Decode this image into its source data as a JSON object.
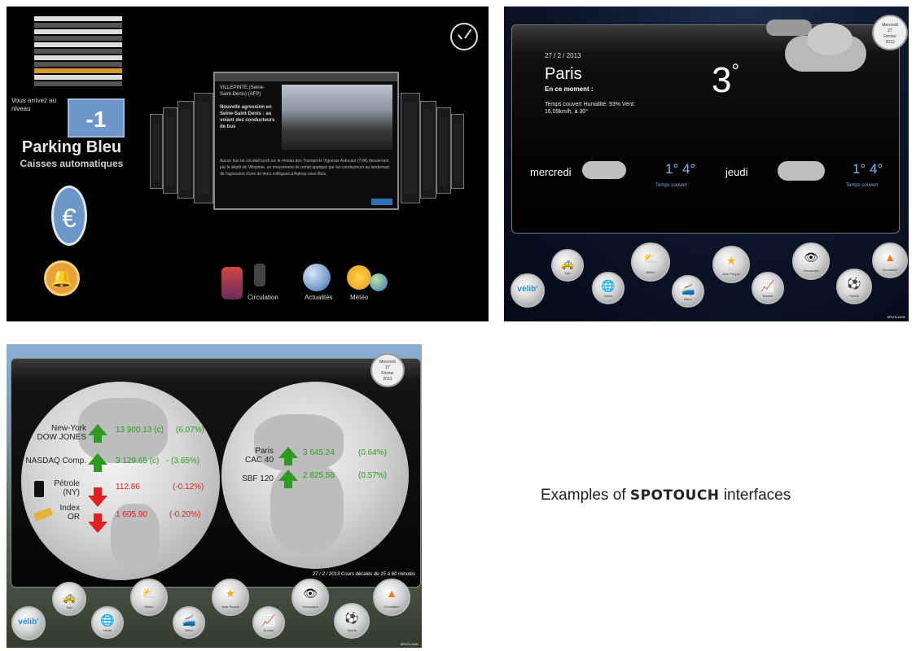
{
  "panel1": {
    "level_message": "Vous arrivez au niveau",
    "level_number": "-1",
    "parking_name": "Parking Bleu",
    "parking_subtitle": "Caisses automatiques",
    "euro_symbol": "€",
    "bell_symbol": "🔔",
    "news_title": "VILLEPINTE (Seine-Saint-Denis) (AFP)",
    "news_subtitle": "Nouvelle agression en Seine-Saint-Denis : au volant des conducteurs de bus",
    "news_body": "Aucun bus ne circulait lundi sur le réseau des Transports Vigneras Autocars (TVA) desservant par le dépôt de Villepinte, un mouvement de retrait appliqué par les conducteurs au lendemain de l'agression d'une de leurs collègues à Aulnay-sous-Bois.",
    "dock_labels": [
      "Circulation",
      "Actualités",
      "Météo"
    ]
  },
  "panel2": {
    "date": "27 / 2 / 2013",
    "city": "Paris",
    "now_label": "En ce moment :",
    "current_desc": "Temps couvert Humidité: 93% Vent: 16.09km/h, à 30°",
    "current_temp": "3",
    "degree": "°",
    "forecast": [
      {
        "day": "mercredi",
        "range": "1° 4°",
        "condition": "Temps couvert"
      },
      {
        "day": "jeudi",
        "range": "1° 4°",
        "condition": "Temps couvert"
      }
    ],
    "calendar": {
      "weekday": "Mercredi",
      "day": "27",
      "month": "Février",
      "year": "2013"
    },
    "dock": [
      {
        "label": "",
        "icon": "velib-logo-icon"
      },
      {
        "label": "Taxi",
        "icon": "taxi-icon"
      },
      {
        "label": "News",
        "icon": "globe-icon"
      },
      {
        "label": "Météo",
        "icon": "weather-icon"
      },
      {
        "label": "Métro",
        "icon": "metro-icon"
      },
      {
        "label": "Actu People",
        "icon": "star-icon"
      },
      {
        "label": "Bourse",
        "icon": "chart-icon"
      },
      {
        "label": "Horoscope",
        "icon": "eye-icon"
      },
      {
        "label": "Sports",
        "icon": "soccer-ball-icon"
      },
      {
        "label": "Circulation",
        "icon": "traffic-cone-icon"
      }
    ],
    "brand": "SPOTLOOK"
  },
  "panel3": {
    "left_rows": [
      {
        "name": "New-York",
        "name2": "DOW JONES",
        "value": "13 900.13 (c)",
        "change": "(6.07%)",
        "dir": "up"
      },
      {
        "name": "NASDAQ Comp.",
        "name2": "",
        "value": "3 129.65 (c)",
        "change": "- (3.65%)",
        "dir": "up"
      },
      {
        "name": "Pétrole",
        "name2": "(NY)",
        "value": "112.86",
        "change": "(-0.12%)",
        "dir": "down"
      },
      {
        "name": "Index",
        "name2": "OR",
        "value": "1 605.90",
        "change": "(-0.20%)",
        "dir": "down"
      }
    ],
    "right_rows": [
      {
        "name": "Paris",
        "name2": "CAC 40",
        "value": "3 645.24",
        "change": "(0.64%)",
        "dir": "up"
      },
      {
        "name": "SBF 120",
        "name2": "",
        "value": "2 825.58",
        "change": "(0.57%)",
        "dir": "up"
      }
    ],
    "footer": "27 / 2 / 2013  Cours décalés de 15 à 60 minutes",
    "calendar": {
      "weekday": "Mercredi",
      "day": "27",
      "month": "Février",
      "year": "2013"
    },
    "dock": [
      {
        "label": "",
        "icon": "velib-logo-icon"
      },
      {
        "label": "Taxi",
        "icon": "taxi-icon"
      },
      {
        "label": "News",
        "icon": "globe-icon"
      },
      {
        "label": "Météo",
        "icon": "weather-icon"
      },
      {
        "label": "Métro",
        "icon": "metro-icon"
      },
      {
        "label": "Actu People",
        "icon": "star-icon"
      },
      {
        "label": "Bourse",
        "icon": "chart-icon"
      },
      {
        "label": "Horoscope",
        "icon": "eye-icon"
      },
      {
        "label": "Sports",
        "icon": "soccer-ball-icon"
      },
      {
        "label": "Circulation",
        "icon": "traffic-cone-icon"
      }
    ],
    "brand": "SPOTLOOK"
  },
  "caption": {
    "prefix": "Examples of ",
    "brand": "SPOTOUCH",
    "suffix": " interfaces"
  }
}
